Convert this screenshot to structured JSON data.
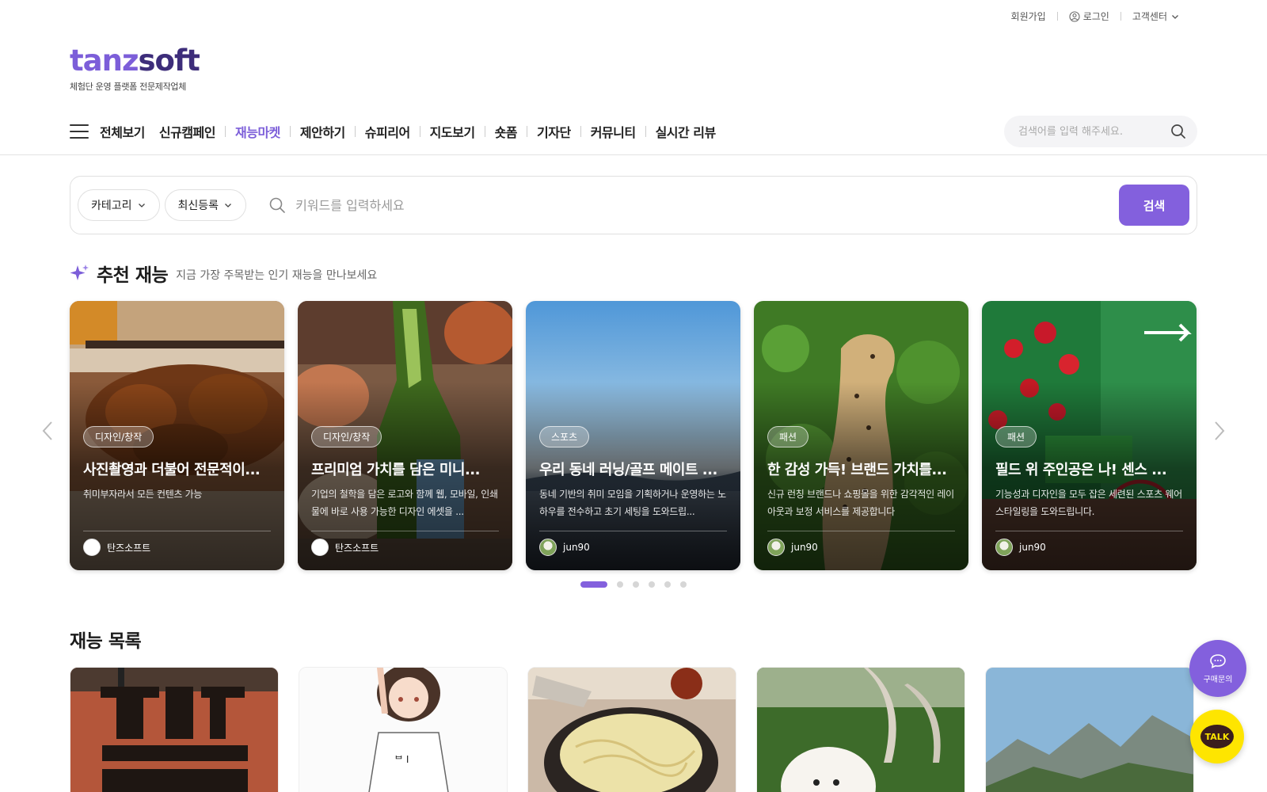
{
  "util_bar": {
    "signup": "회원가입",
    "login": "로그인",
    "support": "고객센터"
  },
  "logo": {
    "part1": "tanz",
    "part2": "soft",
    "subtitle": "체험단 운영 플랫폼 전문제작업체"
  },
  "nav": {
    "items": [
      "전체보기",
      "신규캠페인",
      "재능마켓",
      "제안하기",
      "슈피리어",
      "지도보기",
      "숏폼",
      "기자단",
      "커뮤니티",
      "실시간 리뷰"
    ],
    "active_index": 2
  },
  "top_search": {
    "placeholder": "검색어를 입력 해주세요."
  },
  "filter": {
    "category": "카테고리",
    "sort": "최신등록",
    "keyword_placeholder": "키워드를 입력하세요",
    "search_button": "검색"
  },
  "recommended": {
    "title": "추천 재능",
    "subtitle": "지금 가장 주목받는 인기 재능을 만나보세요",
    "cards": [
      {
        "tag": "디자인/창작",
        "title": "사진촬영과 더불어 전문적이...",
        "desc": "취미부자라서 모든 컨텐츠 가능",
        "author": "탄즈소프트"
      },
      {
        "tag": "디자인/창작",
        "title": "프리미엄 가치를 담은 미니...",
        "desc": "기업의 철학을 담은 로고와 함께 웹, 모바일, 인쇄물에 바로 사용 가능한 디자인 에셋을 ...",
        "author": "탄즈소프트"
      },
      {
        "tag": "스포츠",
        "title": "우리 동네 러닝/골프 메이트 ...",
        "desc": "동네 기반의 취미 모임을 기획하거나 운영하는 노하우를 전수하고 초기 세팅을 도와드립...",
        "author": "jun90"
      },
      {
        "tag": "패션",
        "title": "한 감성 가득! 브랜드 가치를...",
        "desc": "신규 런칭 브랜드나 쇼핑몰을 위한 감각적인 레이아웃과 보정 서비스를 제공합니다",
        "author": "jun90"
      },
      {
        "tag": "패션",
        "title": "필드 위 주인공은 나! 센스 ...",
        "desc": "기능성과 디자인을 모두 잡은 세련된 스포츠 웨어 스타일링을 도와드립니다.",
        "author": "jun90"
      }
    ],
    "slide_count": 6,
    "active_slide": 0
  },
  "talent_list": {
    "title": "재능 목록"
  },
  "floating": {
    "inquiry": "구매문의",
    "talk": "TALK"
  },
  "colors": {
    "accent": "#8360dd",
    "logo_light": "#7c5ed9",
    "logo_dark": "#3d2d7a",
    "kakao": "#fee500"
  }
}
